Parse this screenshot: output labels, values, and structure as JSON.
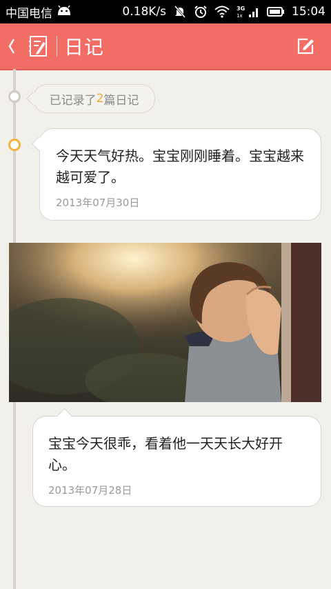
{
  "status_bar": {
    "carrier": "中国电信",
    "speed": "0.18K/s",
    "network": "3G",
    "time": "15:04"
  },
  "app_bar": {
    "title": "日记",
    "back_icon": "chevron-left-icon",
    "notebook_icon": "notebook-icon",
    "edit_icon": "edit-icon"
  },
  "summary": {
    "prefix": "已记录了",
    "count": "2",
    "suffix": "篇日记"
  },
  "entries": [
    {
      "text": "今天天气好热。宝宝刚刚睡着。宝宝越来越可爱了。",
      "date": "2013年07月30日"
    },
    {
      "text": "宝宝今天很乖，看着他一天天长大好开心。",
      "date": "2013年07月28日"
    }
  ],
  "colors": {
    "accent": "#f36d67",
    "count_highlight": "#f0a82b",
    "active_dot": "#f4b23a"
  }
}
